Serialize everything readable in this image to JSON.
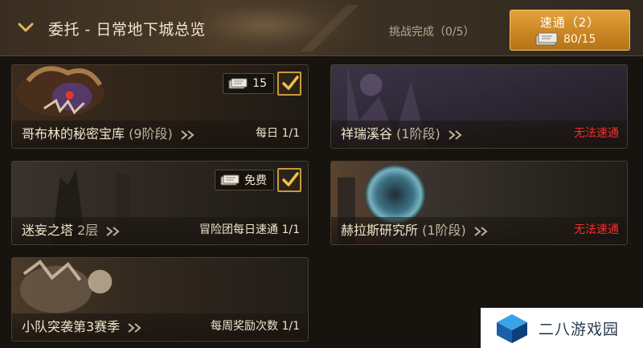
{
  "header": {
    "title": "委托 - 日常地下城总览",
    "challenge": "挑战完成（0/5）",
    "quick_button": {
      "label": "速通（2）",
      "count": "80/15"
    }
  },
  "cards": [
    {
      "name": "哥布林的秘密宝库",
      "stage": "(9阶段)",
      "status": "每日 1/1",
      "status_color": "#efe4ca",
      "cost": "15",
      "checked": true
    },
    {
      "name": "祥瑞溪谷",
      "stage": "(1阶段)",
      "status": "无法速通",
      "status_color": "#ff2a2a",
      "cost": "",
      "checked": false
    },
    {
      "name": "迷妄之塔",
      "stage": "2层",
      "status": "冒险团每日速通 1/1",
      "status_color": "#efe4ca",
      "cost": "免费",
      "checked": true
    },
    {
      "name": "赫拉斯研究所",
      "stage": "(1阶段)",
      "status": "无法速通",
      "status_color": "#ff2a2a",
      "cost": "",
      "checked": false
    },
    {
      "name": "小队突袭第3赛季",
      "stage": "",
      "status": "每周奖励次数 1/1",
      "status_color": "#efe4ca",
      "cost": "",
      "checked": false
    }
  ],
  "watermark": {
    "text": "二八游戏园"
  },
  "colors": {
    "accent": "#c88422",
    "unavailable": "#ff2a2a",
    "check": "#c99a3a"
  }
}
